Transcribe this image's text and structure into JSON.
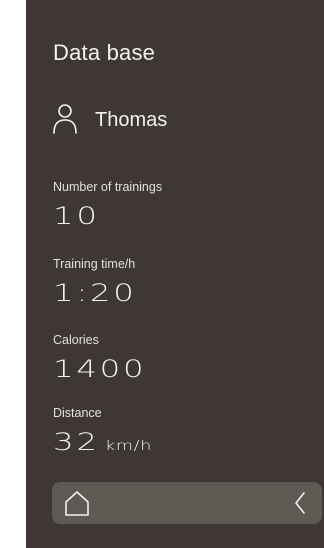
{
  "header": {
    "title": "Data base"
  },
  "user": {
    "name": "Thomas",
    "icon": "person-icon"
  },
  "stats": [
    {
      "label": "Number of trainings",
      "value": "10",
      "unit": ""
    },
    {
      "label": "Training time/h",
      "value": "1:20",
      "unit": ""
    },
    {
      "label": "Calories",
      "value": "1400",
      "unit": ""
    },
    {
      "label": "Distance",
      "value": "32",
      "unit": "km/h"
    }
  ],
  "nav": {
    "home_icon": "home-icon",
    "back_icon": "chevron-left-icon"
  },
  "colors": {
    "panel_bg": "#3e3733",
    "bar_bg": "#5f5954",
    "text": "#f4f1ee"
  }
}
